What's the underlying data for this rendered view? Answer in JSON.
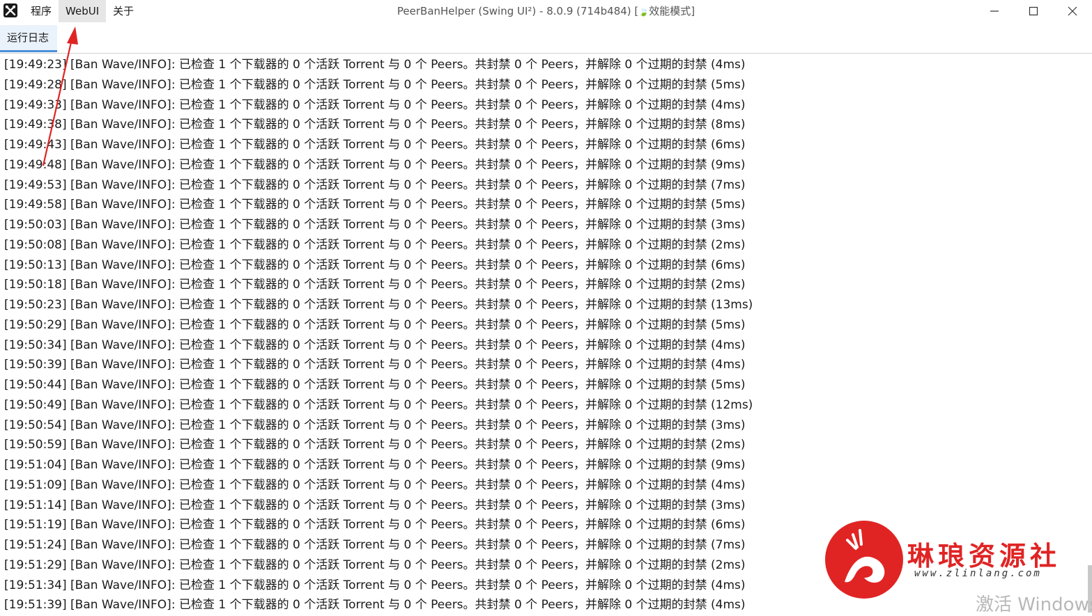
{
  "menu": {
    "items": [
      "程序",
      "WebUI",
      "关于"
    ],
    "active_index": 1
  },
  "window": {
    "title": "PeerBanHelper (Swing UI²) - 8.0.9 (714b484) [",
    "mode_label": "效能模式",
    "title_suffix": "]"
  },
  "tab": {
    "label": "运行日志"
  },
  "log": {
    "lines": [
      "[19:49:23] [Ban Wave/INFO]: 已检查 1 个下载器的 0 个活跃 Torrent 与 0 个 Peers。共封禁 0 个 Peers，并解除 0 个过期的封禁 (4ms)",
      "[19:49:28] [Ban Wave/INFO]: 已检查 1 个下载器的 0 个活跃 Torrent 与 0 个 Peers。共封禁 0 个 Peers，并解除 0 个过期的封禁 (5ms)",
      "[19:49:33] [Ban Wave/INFO]: 已检查 1 个下载器的 0 个活跃 Torrent 与 0 个 Peers。共封禁 0 个 Peers，并解除 0 个过期的封禁 (4ms)",
      "[19:49:38] [Ban Wave/INFO]: 已检查 1 个下载器的 0 个活跃 Torrent 与 0 个 Peers。共封禁 0 个 Peers，并解除 0 个过期的封禁 (8ms)",
      "[19:49:43] [Ban Wave/INFO]: 已检查 1 个下载器的 0 个活跃 Torrent 与 0 个 Peers。共封禁 0 个 Peers，并解除 0 个过期的封禁 (6ms)",
      "[19:49:48] [Ban Wave/INFO]: 已检查 1 个下载器的 0 个活跃 Torrent 与 0 个 Peers。共封禁 0 个 Peers，并解除 0 个过期的封禁 (9ms)",
      "[19:49:53] [Ban Wave/INFO]: 已检查 1 个下载器的 0 个活跃 Torrent 与 0 个 Peers。共封禁 0 个 Peers，并解除 0 个过期的封禁 (7ms)",
      "[19:49:58] [Ban Wave/INFO]: 已检查 1 个下载器的 0 个活跃 Torrent 与 0 个 Peers。共封禁 0 个 Peers，并解除 0 个过期的封禁 (5ms)",
      "[19:50:03] [Ban Wave/INFO]: 已检查 1 个下载器的 0 个活跃 Torrent 与 0 个 Peers。共封禁 0 个 Peers，并解除 0 个过期的封禁 (3ms)",
      "[19:50:08] [Ban Wave/INFO]: 已检查 1 个下载器的 0 个活跃 Torrent 与 0 个 Peers。共封禁 0 个 Peers，并解除 0 个过期的封禁 (2ms)",
      "[19:50:13] [Ban Wave/INFO]: 已检查 1 个下载器的 0 个活跃 Torrent 与 0 个 Peers。共封禁 0 个 Peers，并解除 0 个过期的封禁 (6ms)",
      "[19:50:18] [Ban Wave/INFO]: 已检查 1 个下载器的 0 个活跃 Torrent 与 0 个 Peers。共封禁 0 个 Peers，并解除 0 个过期的封禁 (2ms)",
      "[19:50:23] [Ban Wave/INFO]: 已检查 1 个下载器的 0 个活跃 Torrent 与 0 个 Peers。共封禁 0 个 Peers，并解除 0 个过期的封禁 (13ms)",
      "[19:50:29] [Ban Wave/INFO]: 已检查 1 个下载器的 0 个活跃 Torrent 与 0 个 Peers。共封禁 0 个 Peers，并解除 0 个过期的封禁 (5ms)",
      "[19:50:34] [Ban Wave/INFO]: 已检查 1 个下载器的 0 个活跃 Torrent 与 0 个 Peers。共封禁 0 个 Peers，并解除 0 个过期的封禁 (4ms)",
      "[19:50:39] [Ban Wave/INFO]: 已检查 1 个下载器的 0 个活跃 Torrent 与 0 个 Peers。共封禁 0 个 Peers，并解除 0 个过期的封禁 (4ms)",
      "[19:50:44] [Ban Wave/INFO]: 已检查 1 个下载器的 0 个活跃 Torrent 与 0 个 Peers。共封禁 0 个 Peers，并解除 0 个过期的封禁 (5ms)",
      "[19:50:49] [Ban Wave/INFO]: 已检查 1 个下载器的 0 个活跃 Torrent 与 0 个 Peers。共封禁 0 个 Peers，并解除 0 个过期的封禁 (12ms)",
      "[19:50:54] [Ban Wave/INFO]: 已检查 1 个下载器的 0 个活跃 Torrent 与 0 个 Peers。共封禁 0 个 Peers，并解除 0 个过期的封禁 (3ms)",
      "[19:50:59] [Ban Wave/INFO]: 已检查 1 个下载器的 0 个活跃 Torrent 与 0 个 Peers。共封禁 0 个 Peers，并解除 0 个过期的封禁 (2ms)",
      "[19:51:04] [Ban Wave/INFO]: 已检查 1 个下载器的 0 个活跃 Torrent 与 0 个 Peers。共封禁 0 个 Peers，并解除 0 个过期的封禁 (9ms)",
      "[19:51:09] [Ban Wave/INFO]: 已检查 1 个下载器的 0 个活跃 Torrent 与 0 个 Peers。共封禁 0 个 Peers，并解除 0 个过期的封禁 (4ms)",
      "[19:51:14] [Ban Wave/INFO]: 已检查 1 个下载器的 0 个活跃 Torrent 与 0 个 Peers。共封禁 0 个 Peers，并解除 0 个过期的封禁 (3ms)",
      "[19:51:19] [Ban Wave/INFO]: 已检查 1 个下载器的 0 个活跃 Torrent 与 0 个 Peers。共封禁 0 个 Peers，并解除 0 个过期的封禁 (6ms)",
      "[19:51:24] [Ban Wave/INFO]: 已检查 1 个下载器的 0 个活跃 Torrent 与 0 个 Peers。共封禁 0 个 Peers，并解除 0 个过期的封禁 (7ms)",
      "[19:51:29] [Ban Wave/INFO]: 已检查 1 个下载器的 0 个活跃 Torrent 与 0 个 Peers。共封禁 0 个 Peers，并解除 0 个过期的封禁 (2ms)",
      "[19:51:34] [Ban Wave/INFO]: 已检查 1 个下载器的 0 个活跃 Torrent 与 0 个 Peers。共封禁 0 个 Peers，并解除 0 个过期的封禁 (4ms)",
      "[19:51:39] [Ban Wave/INFO]: 已检查 1 个下载器的 0 个活跃 Torrent 与 0 个 Peers。共封禁 0 个 Peers，并解除 0 个过期的封禁 (4ms)"
    ]
  },
  "watermark": {
    "name": "琳琅资源社",
    "url": "www.zlinlang.com"
  },
  "overlay": {
    "activate_text": "激活 Windows"
  },
  "colors": {
    "arrow": "#e02424",
    "tab_accent": "#4a90d9",
    "watermark_red": "#e02424"
  },
  "icons": {
    "app": "tools-icon",
    "mode": "leaf-icon",
    "minimize": "minimize-icon",
    "maximize": "maximize-icon",
    "close": "close-icon"
  }
}
